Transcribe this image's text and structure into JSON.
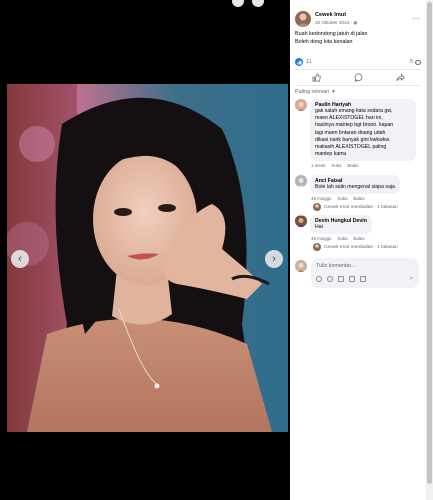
{
  "post": {
    "author": "Cewek Imut",
    "date": "10 Oktober 2024 · ",
    "text_line1": "Buah kedondong jatuh di jalan",
    "text_line2": "Boleh dong kita kenalan",
    "reaction_count": "11",
    "comment_count": "5"
  },
  "sort_label": "Paling relevan",
  "comments": [
    {
      "name": "Paulin Hariyah",
      "lines": [
        "gak salah emang kata sodara gw,",
        "maen ALEXISTOGEL hari ini,",
        "hasilnya mantep bgt brooo. kapan",
        "lagi maen bntaran doang udah",
        "dikasi narik banyak gini kwkwkw.",
        "makasih ALEXISTOGEL paling",
        "mantep kamu"
      ],
      "time": "1 menit",
      "like": "Suka",
      "reply": "Balas"
    },
    {
      "name": "Anci Faisal",
      "lines": [
        "Bole lah salin mengenal siapa saja"
      ],
      "time": "46 minggu",
      "like": "Suka",
      "reply": "Balas",
      "replied": "Cewek Imut membalas · 1 balasan"
    },
    {
      "name": "Devin Hungkul Devin",
      "lines": [
        "Hai"
      ],
      "time": "46 minggu",
      "like": "Suka",
      "reply": "Balas",
      "replied": "Cewek Imut membalas · 1 balasan"
    }
  ],
  "composer": {
    "placeholder": "Tulis komentar..."
  },
  "icons": {
    "nav_left": "chevron-left-icon",
    "nav_right": "chevron-right-icon",
    "like": "thumb-up-icon",
    "comment": "comment-bubble-icon",
    "share": "share-arrow-icon",
    "more": "more-dots-icon"
  },
  "colors": {
    "accent": "#1877f2",
    "panel_bg": "#ffffff",
    "bubble_bg": "#f0f2f5",
    "viewer_bg": "#000000"
  }
}
